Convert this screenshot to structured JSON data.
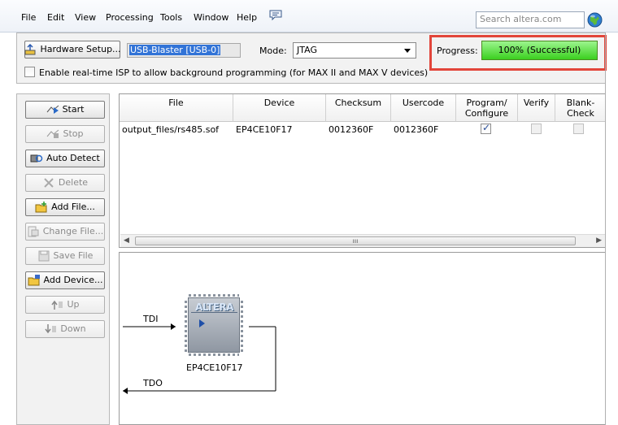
{
  "menu": {
    "items": [
      "File",
      "Edit",
      "View",
      "Processing",
      "Tools",
      "Window",
      "Help"
    ],
    "search_placeholder": "Search altera.com"
  },
  "hardware": {
    "setup_button": "Hardware Setup...",
    "device_value": "USB-Blaster [USB-0]"
  },
  "mode": {
    "label": "Mode:",
    "selected": "JTAG"
  },
  "progress": {
    "label": "Progress:",
    "text": "100% (Successful)",
    "fraction": 1.0,
    "color": "#3bd01f"
  },
  "isp": {
    "label": "Enable real-time ISP to allow background programming (for MAX II and MAX V devices)",
    "checked": false
  },
  "side_buttons": {
    "start": "Start",
    "stop": "Stop",
    "auto_detect": "Auto Detect",
    "delete": "Delete",
    "add_file": "Add File...",
    "change_file": "Change File...",
    "save_file": "Save File",
    "add_device": "Add Device...",
    "up": "Up",
    "down": "Down"
  },
  "table": {
    "headers": {
      "file": "File",
      "device": "Device",
      "checksum": "Checksum",
      "usercode": "Usercode",
      "program_1": "Program/",
      "program_2": "Configure",
      "verify": "Verify",
      "blank_1": "Blank-",
      "blank_2": "Check"
    },
    "rows": [
      {
        "file": "output_files/rs485.sof",
        "device": "EP4CE10F17",
        "checksum": "0012360F",
        "usercode": "0012360F",
        "program": true,
        "verify": false,
        "blank_check": false
      }
    ]
  },
  "chain": {
    "tdi": "TDI",
    "tdo": "TDO",
    "chip_logo": "ALTERA",
    "chip_name": "EP4CE10F17"
  },
  "colors": {
    "highlight": "#e2453a",
    "selection": "#3173d7"
  }
}
